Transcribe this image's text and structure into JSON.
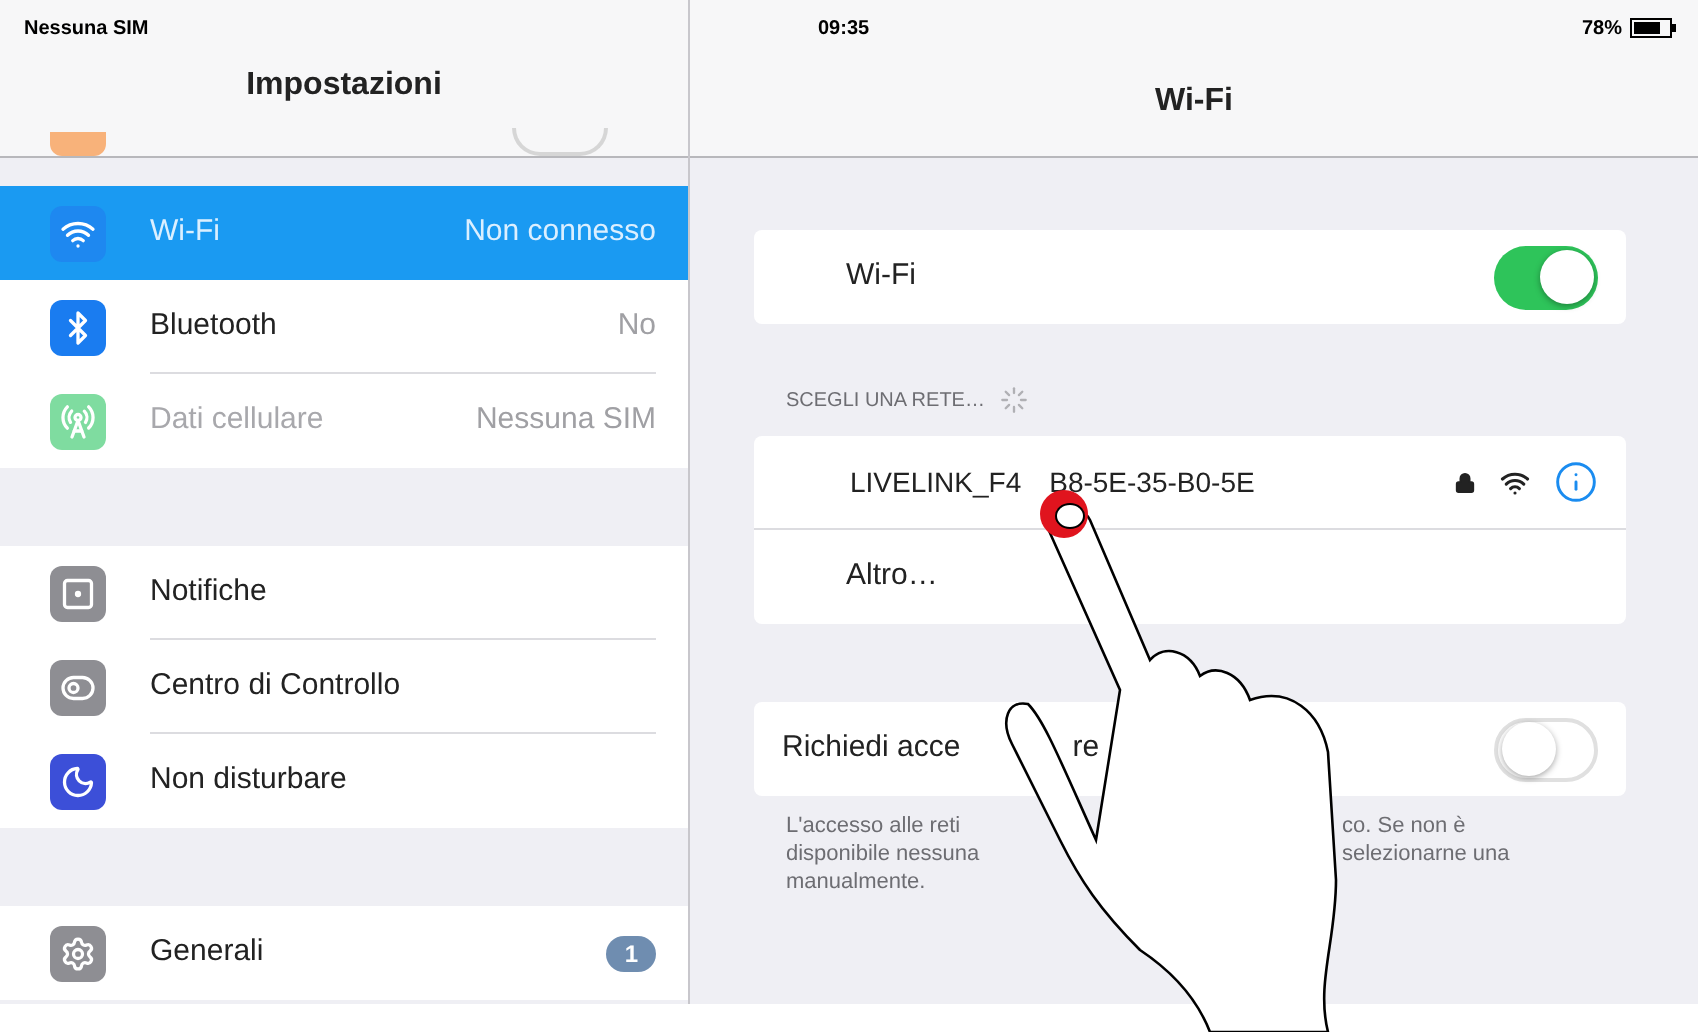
{
  "status_bar": {
    "carrier": "Nessuna SIM",
    "time": "09:35",
    "battery": "78%"
  },
  "sidebar": {
    "title": "Impostazioni",
    "hidden_row": {
      "on": false
    },
    "groups": [
      [
        {
          "kind": "wifi",
          "label": "Wi-Fi",
          "value": "Non connesso",
          "color": "#1e88f0",
          "selected": true,
          "disabled": false
        },
        {
          "kind": "bluetooth",
          "label": "Bluetooth",
          "value": "No",
          "color": "#1a7cf0",
          "selected": false,
          "disabled": false
        },
        {
          "kind": "cellular",
          "label": "Dati cellulare",
          "value": "Nessuna SIM",
          "color": "#7fdca0",
          "selected": false,
          "disabled": true
        }
      ],
      [
        {
          "kind": "notifications",
          "label": "Notifiche",
          "color": "#8e8e93",
          "selected": false,
          "disabled": false
        },
        {
          "kind": "control",
          "label": "Centro di Controllo",
          "color": "#8e8e93",
          "selected": false,
          "disabled": false
        },
        {
          "kind": "moon",
          "label": "Non disturbare",
          "color": "#3c4fd8",
          "selected": false,
          "disabled": false
        }
      ],
      [
        {
          "kind": "gear",
          "label": "Generali",
          "badge": "1",
          "color": "#8e8e93",
          "selected": false,
          "disabled": false
        }
      ]
    ]
  },
  "detail": {
    "title": "Wi-Fi",
    "wifi_card": {
      "label": "Wi-Fi",
      "on": true
    },
    "section_label": "SCEGLI UNA RETE…",
    "scanning": true,
    "networks": [
      {
        "name_parts": [
          "LIVELINK_F4",
          "B8-5E-35-B0-5E"
        ],
        "secure": true
      }
    ],
    "other": "Altro…",
    "ask_to_join": {
      "label_parts": [
        "Richiedi acce",
        "re"
      ],
      "on": false
    },
    "footnote_lines": [
      [
        "L'accesso alle reti",
        "co. Se non è"
      ],
      [
        "disponibile nessuna",
        "selezionarne una"
      ],
      [
        "manualmente."
      ]
    ]
  }
}
